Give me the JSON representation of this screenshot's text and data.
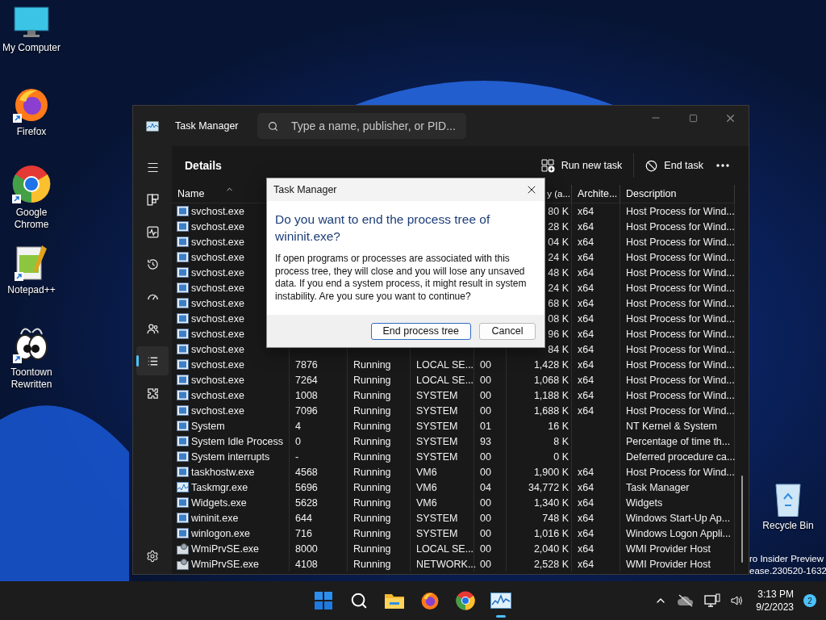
{
  "desktop_icons": [
    {
      "label": "My Computer",
      "kind": "computer",
      "shortcut": false
    },
    {
      "label": "Firefox",
      "kind": "firefox",
      "shortcut": true
    },
    {
      "label": "Google Chrome",
      "kind": "chrome",
      "shortcut": true
    },
    {
      "label": "Notepad++",
      "kind": "notepad",
      "shortcut": true
    },
    {
      "label": "Toontown Rewritten",
      "kind": "toontown",
      "shortcut": true
    }
  ],
  "recycle_bin": {
    "label": "Recycle Bin"
  },
  "watermark": [
    "ro Insider Preview",
    "ease.230520-1632"
  ],
  "window": {
    "title": "Task Manager",
    "search": {
      "placeholder": "Type a name, publisher, or PID..."
    }
  },
  "nav": [
    {
      "kind": "processes",
      "selected": false
    },
    {
      "kind": "performance",
      "selected": false
    },
    {
      "kind": "history",
      "selected": false
    },
    {
      "kind": "startup",
      "selected": false
    },
    {
      "kind": "users",
      "selected": false
    },
    {
      "kind": "details",
      "selected": true
    },
    {
      "kind": "services",
      "selected": false
    }
  ],
  "toolbar": {
    "title": "Details",
    "actions": [
      "Run new task",
      "End task"
    ]
  },
  "table": {
    "columns": [
      "Name",
      "y (a...",
      "Archite...",
      "Description"
    ],
    "rows": [
      {
        "kind": "frame",
        "name": "svchost.exe",
        "memory": "80 K",
        "arch": "x64",
        "description": "Host Process for Wind..."
      },
      {
        "kind": "frame",
        "name": "svchost.exe",
        "memory": "28 K",
        "arch": "x64",
        "description": "Host Process for Wind..."
      },
      {
        "kind": "frame",
        "name": "svchost.exe",
        "memory": "04 K",
        "arch": "x64",
        "description": "Host Process for Wind..."
      },
      {
        "kind": "frame",
        "name": "svchost.exe",
        "memory": "24 K",
        "arch": "x64",
        "description": "Host Process for Wind..."
      },
      {
        "kind": "frame",
        "name": "svchost.exe",
        "memory": "48 K",
        "arch": "x64",
        "description": "Host Process for Wind..."
      },
      {
        "kind": "frame",
        "name": "svchost.exe",
        "memory": "24 K",
        "arch": "x64",
        "description": "Host Process for Wind..."
      },
      {
        "kind": "frame",
        "name": "svchost.exe",
        "memory": "68 K",
        "arch": "x64",
        "description": "Host Process for Wind..."
      },
      {
        "kind": "frame",
        "name": "svchost.exe",
        "memory": "08 K",
        "arch": "x64",
        "description": "Host Process for Wind..."
      },
      {
        "kind": "frame",
        "name": "svchost.exe",
        "memory": "96 K",
        "arch": "x64",
        "description": "Host Process for Wind..."
      },
      {
        "kind": "frame",
        "name": "svchost.exe",
        "memory": "84 K",
        "arch": "x64",
        "description": "Host Process for Wind..."
      },
      {
        "kind": "frame",
        "name": "svchost.exe",
        "pid": "7876",
        "status": "Running",
        "user": "LOCAL SE...",
        "cpu": "00",
        "memory": "1,428 K",
        "arch": "x64",
        "description": "Host Process for Wind..."
      },
      {
        "kind": "frame",
        "name": "svchost.exe",
        "pid": "7264",
        "status": "Running",
        "user": "LOCAL SE...",
        "cpu": "00",
        "memory": "1,068 K",
        "arch": "x64",
        "description": "Host Process for Wind..."
      },
      {
        "kind": "frame",
        "name": "svchost.exe",
        "pid": "1008",
        "status": "Running",
        "user": "SYSTEM",
        "cpu": "00",
        "memory": "1,188 K",
        "arch": "x64",
        "description": "Host Process for Wind..."
      },
      {
        "kind": "frame",
        "name": "svchost.exe",
        "pid": "7096",
        "status": "Running",
        "user": "SYSTEM",
        "cpu": "00",
        "memory": "1,688 K",
        "arch": "x64",
        "description": "Host Process for Wind..."
      },
      {
        "kind": "frame",
        "name": "System",
        "pid": "4",
        "status": "Running",
        "user": "SYSTEM",
        "cpu": "01",
        "memory": "16 K",
        "description": "NT Kernel & System"
      },
      {
        "kind": "frame",
        "name": "System Idle Process",
        "pid": "0",
        "status": "Running",
        "user": "SYSTEM",
        "cpu": "93",
        "memory": "8 K",
        "description": "Percentage of time th..."
      },
      {
        "kind": "frame",
        "name": "System interrupts",
        "pid": "-",
        "status": "Running",
        "user": "SYSTEM",
        "cpu": "00",
        "memory": "0 K",
        "description": "Deferred procedure ca..."
      },
      {
        "kind": "frame",
        "name": "taskhostw.exe",
        "pid": "4568",
        "status": "Running",
        "user": "VM6",
        "cpu": "00",
        "memory": "1,900 K",
        "arch": "x64",
        "description": "Host Process for Wind..."
      },
      {
        "kind": "chart",
        "name": "Taskmgr.exe",
        "pid": "5696",
        "status": "Running",
        "user": "VM6",
        "cpu": "04",
        "memory": "34,772 K",
        "arch": "x64",
        "description": "Task Manager"
      },
      {
        "kind": "frame",
        "name": "Widgets.exe",
        "pid": "5628",
        "status": "Running",
        "user": "VM6",
        "cpu": "00",
        "memory": "1,340 K",
        "arch": "x64",
        "description": "Widgets"
      },
      {
        "kind": "frame",
        "name": "wininit.exe",
        "pid": "644",
        "status": "Running",
        "user": "SYSTEM",
        "cpu": "00",
        "memory": "748 K",
        "arch": "x64",
        "description": "Windows Start-Up Ap..."
      },
      {
        "kind": "frame",
        "name": "winlogon.exe",
        "pid": "716",
        "status": "Running",
        "user": "SYSTEM",
        "cpu": "00",
        "memory": "1,016 K",
        "arch": "x64",
        "description": "Windows Logon Appli..."
      },
      {
        "kind": "gears",
        "name": "WmiPrvSE.exe",
        "pid": "8000",
        "status": "Running",
        "user": "LOCAL SE...",
        "cpu": "00",
        "memory": "2,040 K",
        "arch": "x64",
        "description": "WMI Provider Host"
      },
      {
        "kind": "gears",
        "name": "WmiPrvSE.exe",
        "pid": "4108",
        "status": "Running",
        "user": "NETWORK...",
        "cpu": "00",
        "memory": "2,528 K",
        "arch": "x64",
        "description": "WMI Provider Host"
      }
    ]
  },
  "dialog": {
    "title": "Task Manager",
    "heading": "Do you want to end the process tree of wininit.exe?",
    "message": "If open programs or processes are associated with this process tree, they will close and you will lose any unsaved data. If you end a system process, it might result in system instability. Are you sure you want to continue?",
    "buttons": [
      {
        "label": "End process tree",
        "selected": true
      },
      {
        "label": "Cancel",
        "selected": false
      }
    ]
  },
  "taskbar": {
    "apps": [
      {
        "kind": "start",
        "active": false
      },
      {
        "kind": "search",
        "active": false
      },
      {
        "kind": "explorer",
        "active": false
      },
      {
        "kind": "firefox",
        "active": false
      },
      {
        "kind": "chrome",
        "active": false
      },
      {
        "kind": "taskmgr",
        "active": true
      }
    ],
    "time": "3:13 PM",
    "date": "9/2/2023",
    "badge": "2"
  }
}
